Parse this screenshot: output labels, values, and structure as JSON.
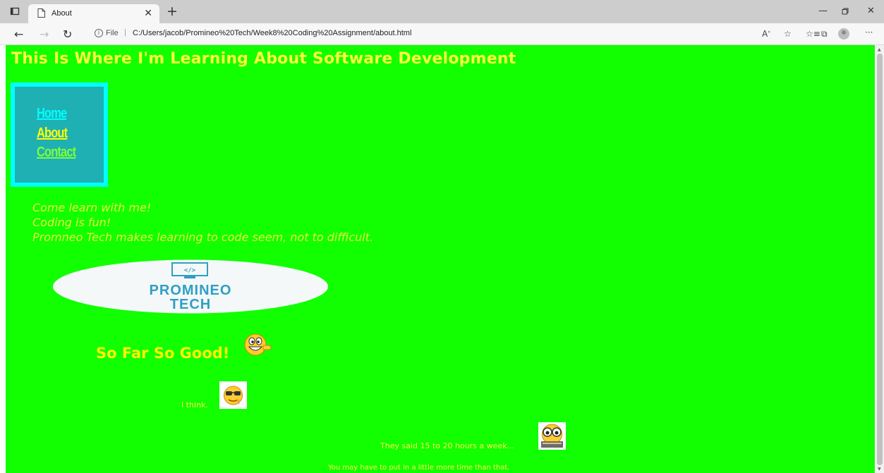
{
  "browser": {
    "tab_title": "About",
    "url_scheme": "File",
    "url": "C:/Users/jacob/Promineo%20Tech/Week8%20Coding%20Assignment/about.html"
  },
  "page": {
    "heading": "This Is Where I'm Learning About Software Development",
    "nav": {
      "home": "Home",
      "about": "About",
      "contact": "Contact"
    },
    "intro_lines": [
      "Come learn with me!",
      "Coding is fun!",
      "Promneo Tech makes learning to code seem, not to difficult."
    ],
    "logo": {
      "line1": "PROMINEO",
      "line2": "TECH"
    },
    "so_far": "So Far So Good!",
    "i_think": "I think.",
    "hours": "They said 15 to 20 hours a week...",
    "more_time": "You may have to put in a little more time than that."
  },
  "colors": {
    "page_bg": "#11ff00",
    "heading": "#fffb3a",
    "nav_box": "#1fb0b4",
    "nav_border": "#00ffff"
  }
}
